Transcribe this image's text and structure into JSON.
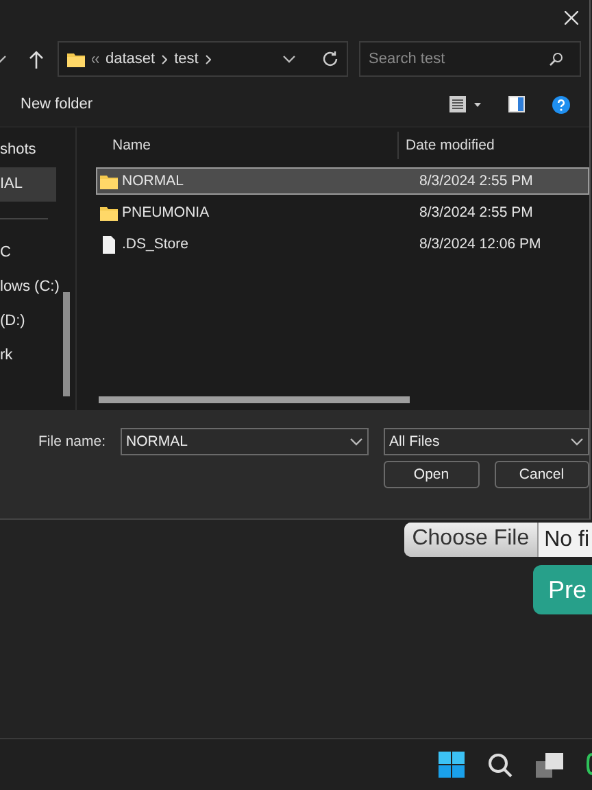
{
  "dialog": {
    "address": {
      "crumbs": [
        "dataset",
        "test"
      ]
    },
    "search": {
      "placeholder": "Search test"
    },
    "command_bar": {
      "new_folder": "New folder"
    },
    "sidebar": {
      "groups": [
        [
          {
            "label": "shots",
            "selected": false
          },
          {
            "label": "IAL",
            "selected": true
          }
        ],
        [
          {
            "label": "C",
            "selected": false
          },
          {
            "label": "lows (C:)",
            "selected": false
          },
          {
            "label": "(D:)",
            "selected": false
          },
          {
            "label": "rk",
            "selected": false
          }
        ]
      ]
    },
    "columns": [
      "Name",
      "Date modified"
    ],
    "files": [
      {
        "name": "NORMAL",
        "date": "8/3/2024 2:55 PM",
        "kind": "folder",
        "selected": true
      },
      {
        "name": "PNEUMONIA",
        "date": "8/3/2024 2:55 PM",
        "kind": "folder",
        "selected": false
      },
      {
        "name": ".DS_Store",
        "date": "8/3/2024 12:06 PM",
        "kind": "file",
        "selected": false
      }
    ],
    "file_name": {
      "label": "File name:",
      "value": "NORMAL"
    },
    "filter": "All Files",
    "buttons": [
      "Open",
      "Cancel"
    ]
  },
  "page": {
    "choose_file": "Choose File",
    "file_status": "No fi",
    "predict_button": "Pre"
  }
}
